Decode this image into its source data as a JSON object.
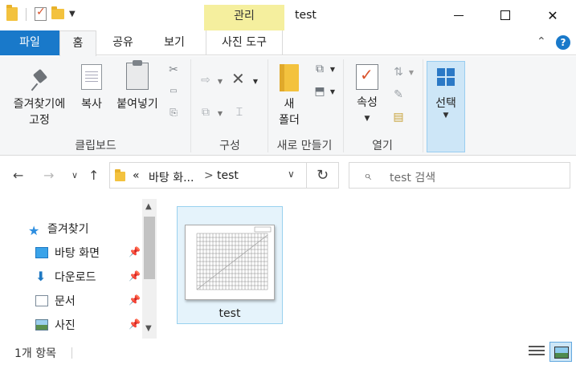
{
  "window": {
    "title": "test",
    "context_tab_group": "관리"
  },
  "tabs": {
    "file": "파일",
    "home": "홈",
    "share": "공유",
    "view": "보기",
    "picture_tools": "사진 도구"
  },
  "ribbon": {
    "pin_quick_access": [
      "즐겨찾기에",
      "고정"
    ],
    "copy": "복사",
    "paste": "붙여넣기",
    "clipboard_group": "클립보드",
    "organize_group": "구성",
    "new_folder": [
      "새",
      "폴더"
    ],
    "new_group": "새로 만들기",
    "properties": "속성",
    "open_group": "열기",
    "select": "선택"
  },
  "address": {
    "overflow": "«",
    "crumb_desktop": "바탕 화...",
    "separator": ">",
    "crumb_current": "test"
  },
  "search": {
    "placeholder": "test 검색"
  },
  "nav_pane": {
    "quick_access": "즐겨찾기",
    "items": [
      {
        "label": "바탕 화면",
        "icon": "desktop-icon"
      },
      {
        "label": "다운로드",
        "icon": "download-icon"
      },
      {
        "label": "문서",
        "icon": "documents-icon"
      },
      {
        "label": "사진",
        "icon": "pictures-icon"
      }
    ]
  },
  "files": [
    {
      "name": "test",
      "type": "image-thumbnail"
    }
  ],
  "status": {
    "item_count": "1개 항목"
  },
  "colors": {
    "file_tab": "#1979ca",
    "context_tab": "#f5ef9e",
    "selection": "#e5f3fb",
    "selection_border": "#99d1ef",
    "folder": "#f3c23e"
  }
}
